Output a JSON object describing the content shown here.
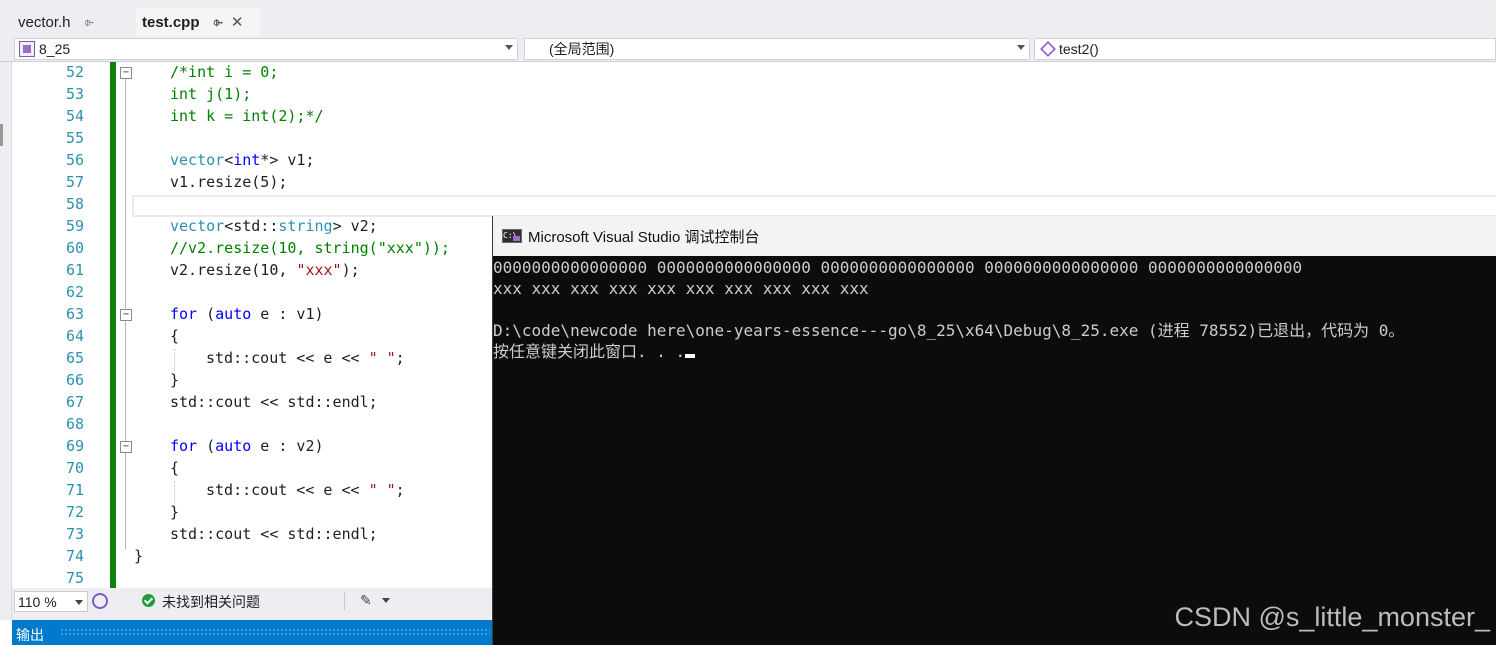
{
  "tabs": [
    {
      "label": "vector.h",
      "pin": "⌱",
      "active": false
    },
    {
      "label": "test.cpp",
      "pin": "⌱",
      "close": "✕",
      "active": true
    }
  ],
  "navbar": {
    "project": "8_25",
    "scope": "(全局范围)",
    "member": "test2()"
  },
  "editor": {
    "line_numbers": [
      "52",
      "53",
      "54",
      "55",
      "56",
      "57",
      "58",
      "59",
      "60",
      "61",
      "62",
      "63",
      "64",
      "65",
      "66",
      "67",
      "68",
      "69",
      "70",
      "71",
      "72",
      "73",
      "74",
      "75"
    ],
    "fold_glyph": "−",
    "code": {
      "l52": "/*int i = 0;",
      "l53": "int j(1);",
      "l54": "int k = int(2);*/",
      "l56_type": "vector",
      "l56_kw": "int",
      "l56_rest": "v1;",
      "l57": "v1.resize(5);",
      "l59_type": "vector",
      "l59_a": "<std::",
      "l59_b": "string",
      "l59_c": "> v2;",
      "l60": "//v2.resize(10, string(\"xxx\"));",
      "l61_a": "v2.resize(10, ",
      "l61_str": "\"xxx\"",
      "l61_b": ");",
      "l63_for": "for",
      "l63_auto": "auto",
      "l63_rest": " e : v1)",
      "l64": "{",
      "l65_a": "std::cout << e << ",
      "l65_str": "\" \"",
      "l65_b": ";",
      "l66": "}",
      "l67": "std::cout << std::endl;",
      "l69_for": "for",
      "l69_auto": "auto",
      "l69_rest": " e : v2)",
      "l70": "{",
      "l71_a": "std::cout << e << ",
      "l71_str": "\" \"",
      "l71_b": ";",
      "l72": "}",
      "l73": "std::cout << std::endl;",
      "l74": "}"
    }
  },
  "statusbar": {
    "zoom": "110 %",
    "issues": "未找到相关问题",
    "brush_icon": "✎"
  },
  "output_panel": {
    "label": "输出"
  },
  "console": {
    "title": "Microsoft Visual Studio 调试控制台",
    "icon_text": "C:\\",
    "lines": [
      "0000000000000000 0000000000000000 0000000000000000 0000000000000000 0000000000000000",
      "xxx xxx xxx xxx xxx xxx xxx xxx xxx xxx",
      "",
      "D:\\code\\newcode here\\one-years-essence---go\\8_25\\x64\\Debug\\8_25.exe (进程 78552)已退出，代码为 0。",
      "按任意键关闭此窗口. . ."
    ]
  },
  "watermark": "CSDN @s_little_monster_",
  "colors": {
    "keyword": "#0000ff",
    "type": "#2b91af",
    "comment": "#008000",
    "string": "#a31515",
    "line_number": "#2b91af",
    "change_bar": "#108010",
    "accent": "#007acc",
    "console_bg": "#0c0c0c"
  }
}
